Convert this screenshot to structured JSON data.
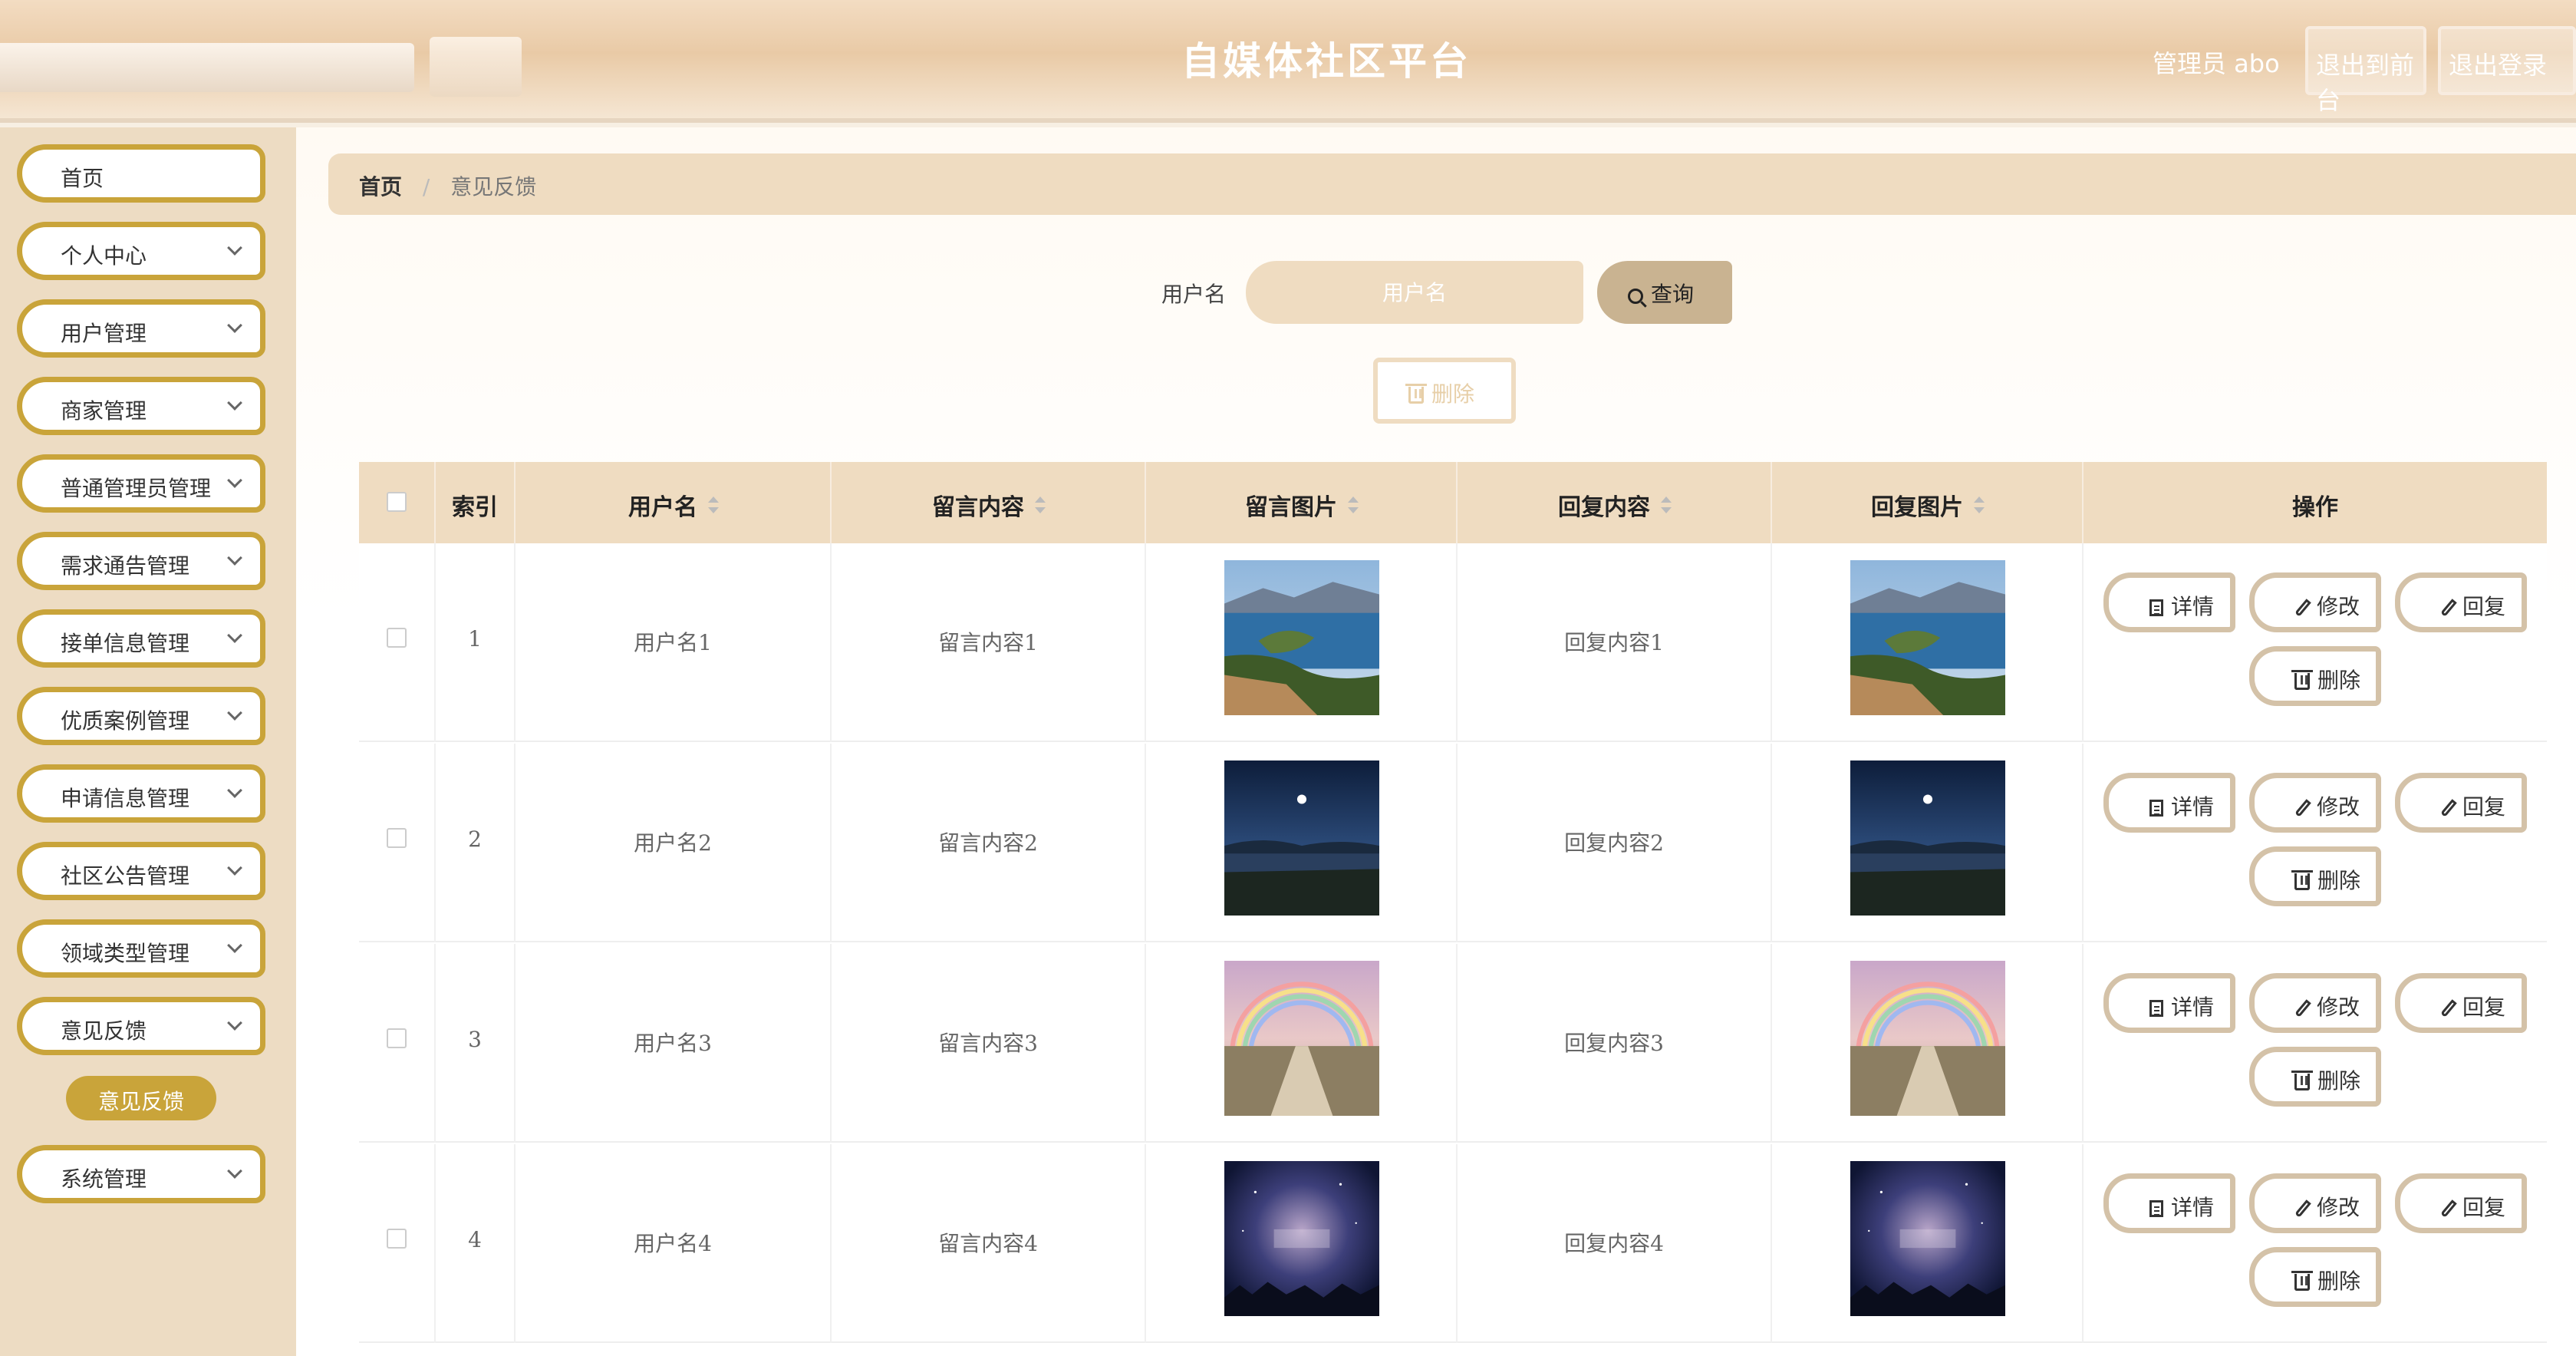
{
  "header": {
    "title": "自媒体社区平台",
    "admin_label": "管理员 abo",
    "exit_front": "退出到前台",
    "exit_login": "退出登录"
  },
  "sidebar": {
    "items": [
      {
        "label": "首页",
        "has_chevron": false
      },
      {
        "label": "个人中心",
        "has_chevron": true
      },
      {
        "label": "用户管理",
        "has_chevron": true
      },
      {
        "label": "商家管理",
        "has_chevron": true
      },
      {
        "label": "普通管理员管理",
        "has_chevron": true
      },
      {
        "label": "需求通告管理",
        "has_chevron": true
      },
      {
        "label": "接单信息管理",
        "has_chevron": true
      },
      {
        "label": "优质案例管理",
        "has_chevron": true
      },
      {
        "label": "申请信息管理",
        "has_chevron": true
      },
      {
        "label": "社区公告管理",
        "has_chevron": true
      },
      {
        "label": "领域类型管理",
        "has_chevron": true
      },
      {
        "label": "意见反馈",
        "has_chevron": true
      },
      {
        "label": "系统管理",
        "has_chevron": true
      }
    ],
    "active_submenu": "意见反馈"
  },
  "breadcrumb": {
    "home": "首页",
    "current": "意见反馈"
  },
  "search": {
    "label": "用户名",
    "placeholder": "用户名",
    "value": "",
    "button_label": "查询"
  },
  "bulk_delete_label": "删除",
  "table": {
    "columns": [
      "索引",
      "用户名",
      "留言内容",
      "留言图片",
      "回复内容",
      "回复图片",
      "操作"
    ],
    "rows": [
      {
        "index": "1",
        "username": "用户名1",
        "content": "留言内容1",
        "reply": "回复内容1",
        "image": "lake-islands"
      },
      {
        "index": "2",
        "username": "用户名2",
        "content": "留言内容2",
        "reply": "回复内容2",
        "image": "night-moon-lake"
      },
      {
        "index": "3",
        "username": "用户名3",
        "content": "留言内容3",
        "reply": "回复内容3",
        "image": "rainbow-flower-path"
      },
      {
        "index": "4",
        "username": "用户名4",
        "content": "留言内容4",
        "reply": "回复内容4",
        "image": "starry-sky-logo"
      }
    ],
    "actions": {
      "detail": "详情",
      "edit": "修改",
      "reply": "回复",
      "delete": "删除"
    }
  },
  "colors": {
    "accent": "#c9a43a",
    "beige": "#efdcc1",
    "sidebar_bg": "#eddcc3",
    "button_border": "#d4c2a8"
  }
}
